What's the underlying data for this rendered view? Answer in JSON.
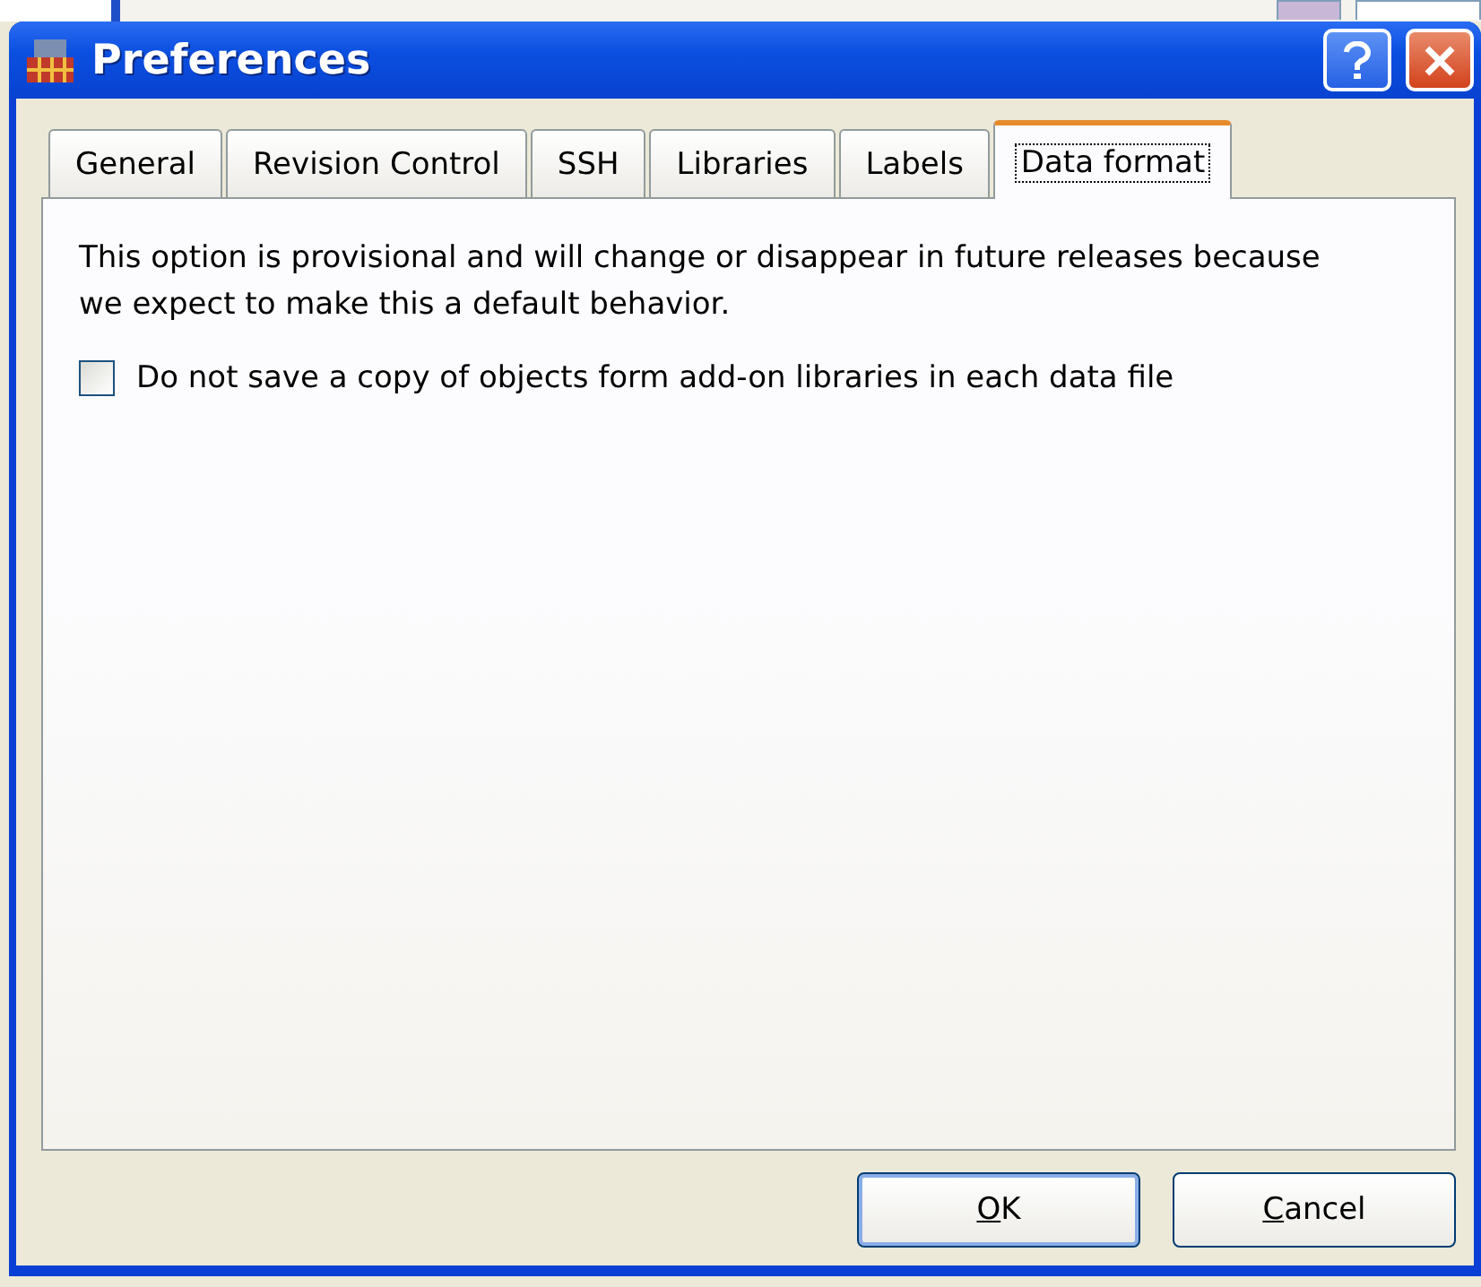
{
  "window": {
    "title": "Preferences"
  },
  "tabs": [
    {
      "label": "General",
      "selected": false
    },
    {
      "label": "Revision Control",
      "selected": false
    },
    {
      "label": "SSH",
      "selected": false
    },
    {
      "label": "Libraries",
      "selected": false
    },
    {
      "label": "Labels",
      "selected": false
    },
    {
      "label": "Data format",
      "selected": true
    }
  ],
  "description": "This option is provisional and will change or disappear in future releases because we expect to make this a default behavior.",
  "options": [
    {
      "label": "Do not save a copy of objects form add-on libraries in each data file",
      "checked": false
    }
  ],
  "buttons": [
    {
      "label": "OK",
      "default": true
    },
    {
      "label": "Cancel",
      "default": false
    }
  ]
}
